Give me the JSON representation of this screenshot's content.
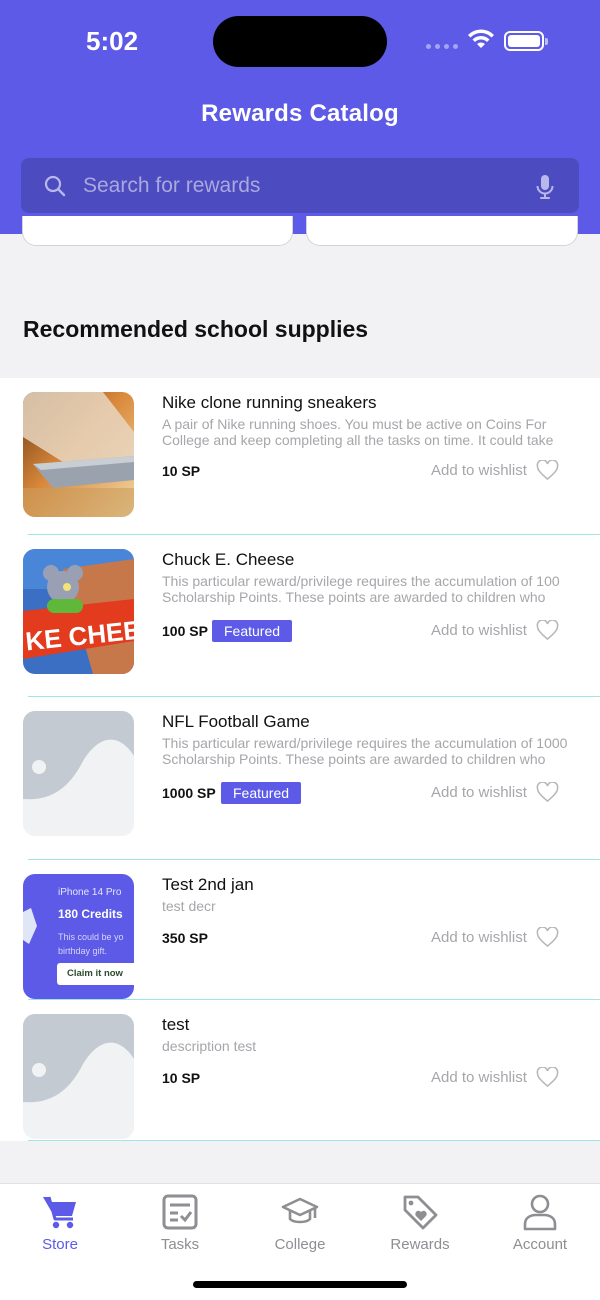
{
  "status_bar": {
    "time": "5:02"
  },
  "header": {
    "title": "Rewards Catalog",
    "search_placeholder": "Search for rewards"
  },
  "section": {
    "title": "Recommended school supplies"
  },
  "items": [
    {
      "name": "Nike clone running sneakers",
      "description": "A pair of Nike running shoes. You must be active on Coins For College and keep completing all the tasks on time. It could take",
      "price": "10 SP",
      "featured": "",
      "wishlist": "Add to wishlist",
      "image": "laptop-photo"
    },
    {
      "name": "Chuck E. Cheese",
      "description": "This particular reward/privilege requires the accumulation of 100 Scholarship Points. These points are awarded to children who",
      "price": "100 SP",
      "featured": "Featured",
      "wishlist": "Add to wishlist",
      "image": "chuck-e-cheese-photo"
    },
    {
      "name": "NFL Football Game",
      "description": "This particular reward/privilege requires the accumulation of 1000 Scholarship Points. These points are awarded to children who",
      "price": "1000 SP",
      "featured": "Featured",
      "wishlist": "Add to wishlist",
      "image": "placeholder-image"
    },
    {
      "name": "Test 2nd jan",
      "description": "test decr",
      "price": "350 SP",
      "featured": "",
      "wishlist": "Add to wishlist",
      "image": "credits-promo",
      "promo": {
        "device": "iPhone 14 Pro",
        "credits": "180 Credits",
        "line1": "This could be yo",
        "line2": "birthday gift.",
        "cta": "Claim it now"
      }
    },
    {
      "name": "test",
      "description": "description test",
      "price": "10 SP",
      "featured": "",
      "wishlist": "Add to wishlist",
      "image": "placeholder-image"
    }
  ],
  "tabs": [
    {
      "label": "Store",
      "icon": "cart-icon",
      "active": true
    },
    {
      "label": "Tasks",
      "icon": "checklist-icon",
      "active": false
    },
    {
      "label": "College",
      "icon": "graduation-cap-icon",
      "active": false
    },
    {
      "label": "Rewards",
      "icon": "tag-heart-icon",
      "active": false
    },
    {
      "label": "Account",
      "icon": "person-icon",
      "active": false
    }
  ],
  "colors": {
    "primary": "#5c5ae6",
    "search_bg": "#4c4bbf",
    "divider": "#9fe5e5",
    "muted_text": "#a6a6ab"
  }
}
